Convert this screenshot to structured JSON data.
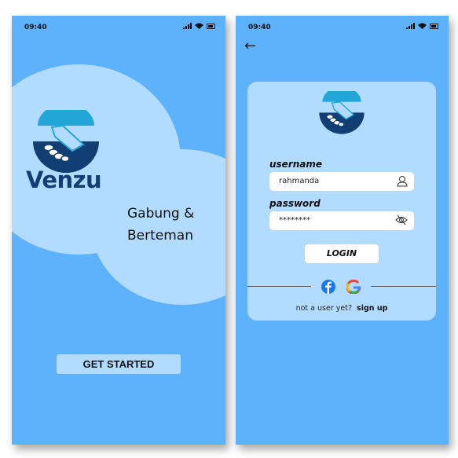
{
  "screen1": {
    "time": "09:40",
    "brand": "Venzu",
    "tagline_line1": "Gabung &",
    "tagline_line2": "Berteman",
    "get_started": "GET STARTED"
  },
  "screen2": {
    "time": "09:40",
    "back": "←",
    "username_label": "username",
    "username_value": "rahmanda",
    "password_label": "password",
    "password_value": "********",
    "login": "LOGIN",
    "signup_prompt": "not a user yet?",
    "signup_link": "sign up"
  },
  "colors": {
    "bg": "#5eb2fc",
    "light": "#b1dcff",
    "navy": "#123f73",
    "teal": "#22a6d8"
  }
}
